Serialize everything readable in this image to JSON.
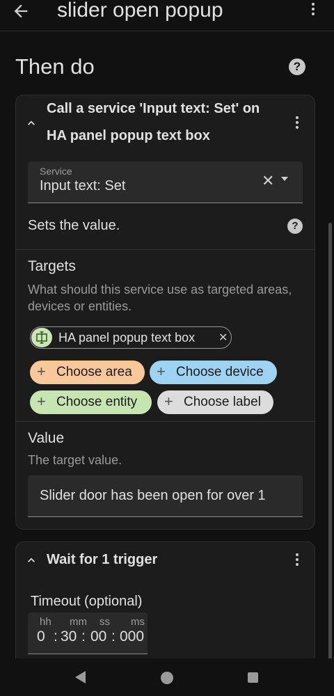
{
  "header": {
    "title": "slider open popup"
  },
  "section": {
    "title": "Then do"
  },
  "action_card": {
    "title_line1": "Call a service 'Input text: Set' on",
    "title_line2": "HA panel popup text box",
    "service": {
      "label": "Service",
      "value": "Input text: Set"
    },
    "description": "Sets the value.",
    "targets": {
      "title": "Targets",
      "description": "What should this service use as targeted areas, devices or entities.",
      "selected": {
        "label": "HA panel popup text box",
        "icon": "input-text-icon"
      },
      "add_buttons": [
        {
          "label": "Choose area",
          "color": "#f8c89b"
        },
        {
          "label": "Choose device",
          "color": "#9fd3f3"
        },
        {
          "label": "Choose entity",
          "color": "#c6e5b0"
        },
        {
          "label": "Choose label",
          "color": "#dcdcdc"
        }
      ]
    },
    "value": {
      "title": "Value",
      "description": "The target value.",
      "input_value": "Slider door has been open for over 1"
    }
  },
  "wait_card": {
    "title": "Wait for 1 trigger",
    "timeout": {
      "label": "Timeout (optional)",
      "units": {
        "hh": "hh",
        "mm": "mm",
        "ss": "ss",
        "ms": "ms"
      },
      "values": {
        "hh": "0",
        "mm": "30",
        "ss": "00",
        "ms": "000"
      },
      "sep": ":"
    }
  },
  "icons": {
    "back": "arrow-left-icon",
    "overflow": "dots-vertical-icon",
    "help": "help-circle-icon",
    "collapse": "chevron-up-icon",
    "clear": "close-icon",
    "dropdown": "menu-down-icon",
    "plus": "plus-icon"
  },
  "colors": {
    "background": "#111111",
    "card": "#1c1c1c",
    "field": "#2a2a2a",
    "text": "#e1e1e1",
    "secondary_text": "#9a9a9a"
  }
}
